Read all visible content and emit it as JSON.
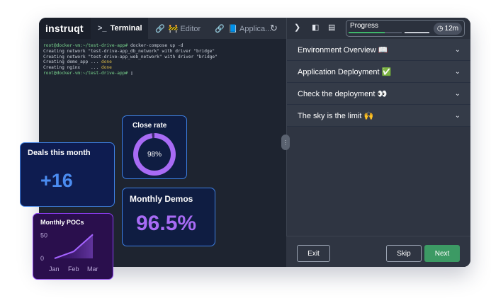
{
  "topbar": {
    "logo": "instruqt",
    "tabs": [
      {
        "icon": ">_",
        "label": "Terminal"
      },
      {
        "icon": "🔗",
        "label": "🚧 Editor"
      },
      {
        "icon": "🔗",
        "label": "📘 Applica..."
      }
    ],
    "refresh_icon": "refresh-icon",
    "progress_label": "Progress",
    "progress_value": 0.68,
    "timer": "12m"
  },
  "terminal": {
    "lines": [
      {
        "prompt": "root@docker-vm:~/test-drive-app#",
        "text": " docker-compose up -d"
      },
      {
        "prompt": "",
        "text": "Creating network \"test-drive-app_db_network\" with driver \"bridge\""
      },
      {
        "prompt": "",
        "text": "Creating network \"test-drive-app_web_network\" with driver \"bridge\""
      },
      {
        "prompt": "",
        "text": "Creating demo_app ... ",
        "status": "done"
      },
      {
        "prompt": "",
        "text": "Creating nginx    ... ",
        "status": "done"
      },
      {
        "prompt": "root@docker-vm:~/test-drive-app#",
        "text": " ▯"
      }
    ]
  },
  "sidebar": {
    "items": [
      {
        "label": "Environment Overview 📖"
      },
      {
        "label": "Application Deployment ✅"
      },
      {
        "label": "Check the deployment 👀"
      },
      {
        "label": "The sky is the limit 🙌"
      }
    ],
    "exit_label": "Exit",
    "skip_label": "Skip",
    "next_label": "Next"
  },
  "cards": {
    "close_rate": {
      "title": "Close rate",
      "value": "98%",
      "fraction": 0.98
    },
    "deals": {
      "title": "Deals this month",
      "value": "+16"
    },
    "demos": {
      "title": "Monthly Demos",
      "value": "96.5%"
    },
    "pocs": {
      "title": "Monthly POCs"
    }
  },
  "chart_data": {
    "type": "line",
    "title": "Monthly POCs",
    "categories": [
      "Jan",
      "Feb",
      "Mar"
    ],
    "values": [
      0,
      15,
      52
    ],
    "yticks": [
      0,
      50
    ],
    "ylim": [
      0,
      60
    ],
    "xlabel": "",
    "ylabel": ""
  },
  "colors": {
    "accent_green": "#3c9a64",
    "ring": "#a86bf5",
    "line": "#8a3df0"
  }
}
